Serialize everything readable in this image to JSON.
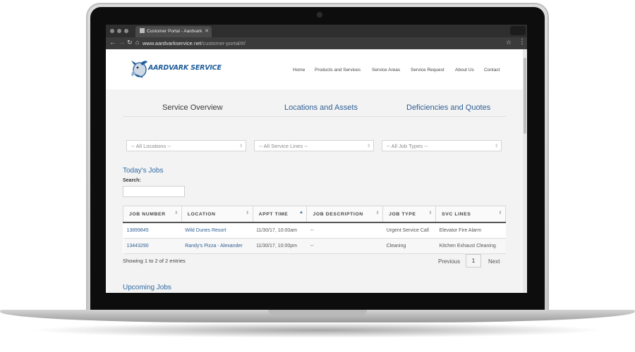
{
  "browser": {
    "tab_title": "Customer Portal - Aardvark Se",
    "url_domain": "www.aardvarkservice.net",
    "url_path": "/customer-portal/#/"
  },
  "site": {
    "logo_text": "AARDVARK SERVICE",
    "nav": [
      "Home",
      "Products and Services",
      "Service Areas",
      "Service Request",
      "About Us",
      "Contact"
    ]
  },
  "portal_tabs": [
    {
      "label": "Service Overview",
      "color": "#3a3a3a"
    },
    {
      "label": "Locations and Assets",
      "color": "#2f5f94"
    },
    {
      "label": "Deficiencies and Quotes",
      "color": "#2f5f94"
    }
  ],
  "filters": {
    "locations": "-- All Locations --",
    "service_lines": "-- All Service Lines --",
    "job_types": "-- All Job Types --"
  },
  "todays_jobs": {
    "title": "Today's Jobs",
    "search_label": "Search:",
    "columns": [
      "JOB NUMBER",
      "LOCATION",
      "APPT TIME",
      "JOB DESCRIPTION",
      "JOB TYPE",
      "SVC LINES"
    ],
    "rows": [
      {
        "job_number": "13899845",
        "location": "Wild Dunes Resort",
        "appt_time": "11/30/17, 10:00am",
        "description": "--",
        "job_type": "Urgent Service Call",
        "svc_lines": "Elevator Fire Alarm"
      },
      {
        "job_number": "13443290",
        "location": "Randy's Pizza - Alexander",
        "appt_time": "11/30/17, 10:00pm",
        "description": "--",
        "job_type": "Cleaning",
        "svc_lines": "Kitchen Exhaust Cleaning"
      }
    ],
    "showing_text": "Showing 1 to 2 of 2 entries",
    "pager": {
      "prev": "Previous",
      "page": "1",
      "next": "Next"
    }
  },
  "upcoming_jobs": {
    "title": "Upcoming Jobs"
  }
}
